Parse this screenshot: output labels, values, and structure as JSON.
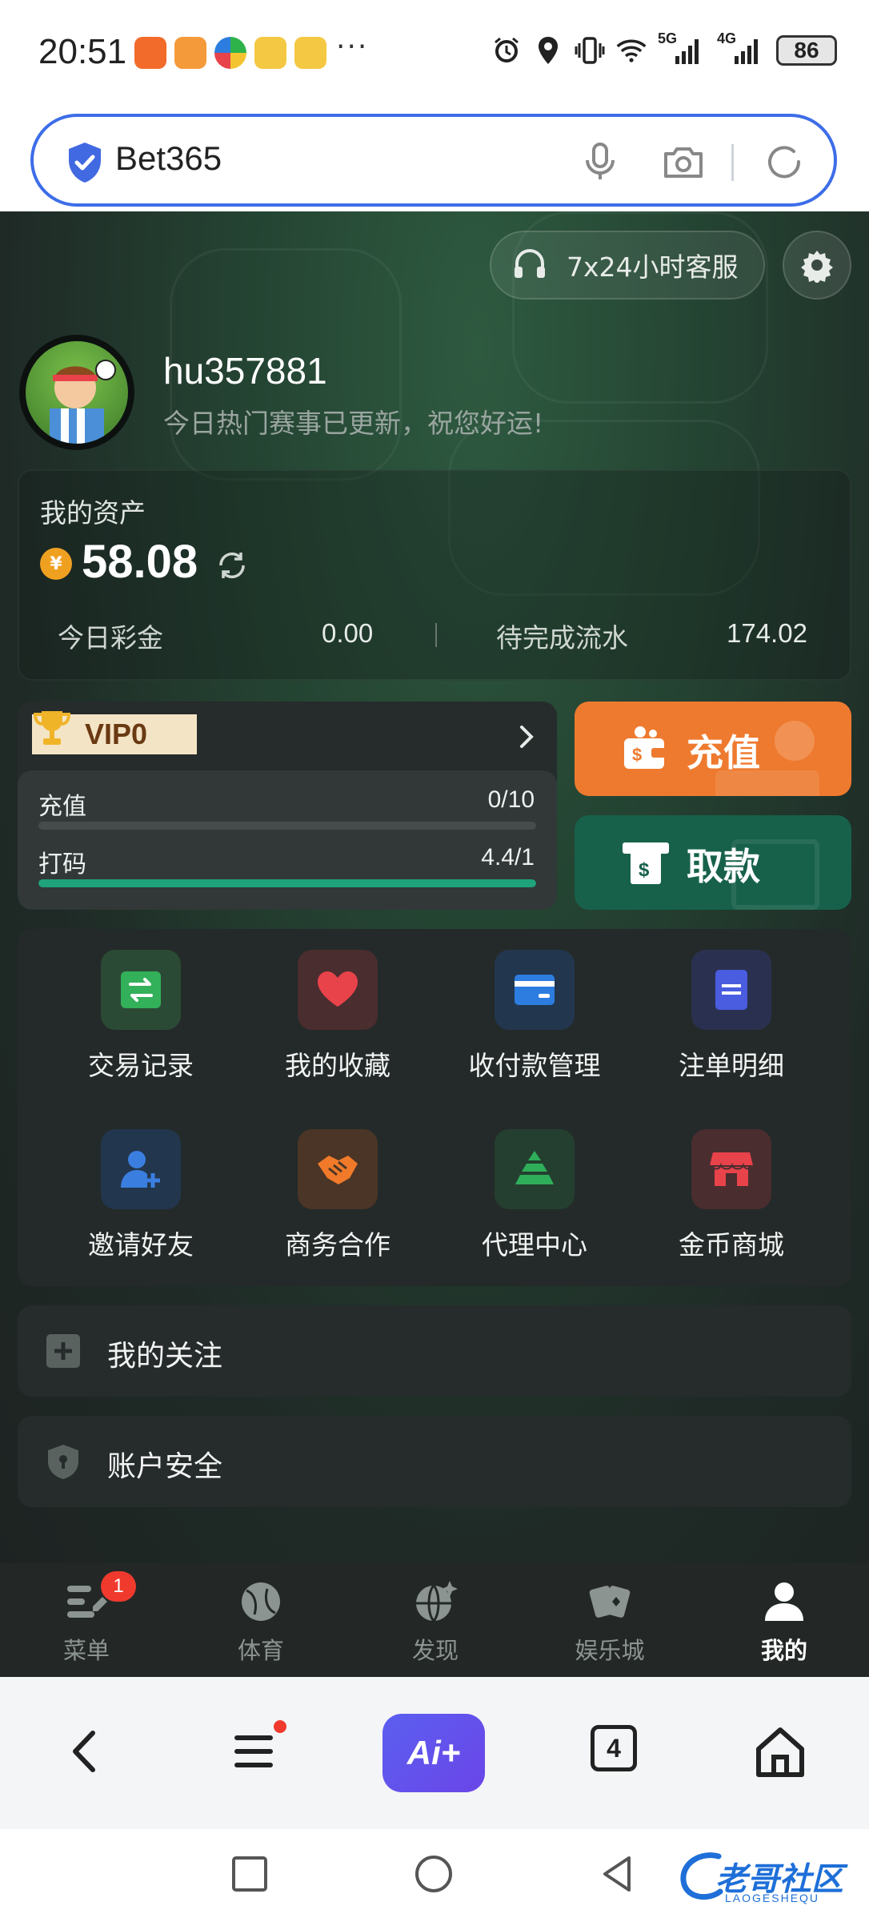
{
  "status_bar": {
    "time": "20:51",
    "more": "···",
    "network_5g": "5G",
    "network_4g": "4G",
    "battery": "86"
  },
  "browser": {
    "url_text": "Bet365"
  },
  "header": {
    "service_label": "7x24小时客服"
  },
  "profile": {
    "username": "hu357881",
    "greeting": "今日热门赛事已更新，祝您好运!"
  },
  "assets": {
    "title": "我的资产",
    "coin_symbol": "¥",
    "amount": "58.08",
    "today_bonus_label": "今日彩金",
    "today_bonus_value": "0.00",
    "pending_label": "待完成流水",
    "pending_value": "174.02"
  },
  "vip": {
    "level": "VIP0",
    "recharge_label": "充值",
    "recharge_value": "0/10",
    "recharge_progress": 0,
    "bet_label": "打码",
    "bet_value": "4.4/1",
    "bet_progress": 1.0
  },
  "actions": {
    "recharge": "充值",
    "withdraw": "取款"
  },
  "grid": [
    {
      "label": "交易记录",
      "icon": "transfer-icon",
      "color": "#2f9a4a"
    },
    {
      "label": "我的收藏",
      "icon": "heart-icon",
      "color": "#e8424a"
    },
    {
      "label": "收付款管理",
      "icon": "card-icon",
      "color": "#2d7de0"
    },
    {
      "label": "注单明细",
      "icon": "document-icon",
      "color": "#4a5ce0"
    },
    {
      "label": "邀请好友",
      "icon": "add-user-icon",
      "color": "#3a7fe0"
    },
    {
      "label": "商务合作",
      "icon": "handshake-icon",
      "color": "#f07a2a"
    },
    {
      "label": "代理中心",
      "icon": "pyramid-icon",
      "color": "#2fae5a"
    },
    {
      "label": "金币商城",
      "icon": "shop-icon",
      "color": "#e8424a"
    }
  ],
  "rows": {
    "follow": "我的关注",
    "security": "账户安全"
  },
  "tabbar": {
    "items": [
      {
        "label": "菜单",
        "badge": "1"
      },
      {
        "label": "体育"
      },
      {
        "label": "发现"
      },
      {
        "label": "娱乐城"
      },
      {
        "label": "我的"
      }
    ]
  },
  "browser_bottom": {
    "ai_label": "Ai+",
    "tab_count": "4"
  },
  "watermark": {
    "text": "老哥社区",
    "sub": "LAOGESHEQU"
  }
}
